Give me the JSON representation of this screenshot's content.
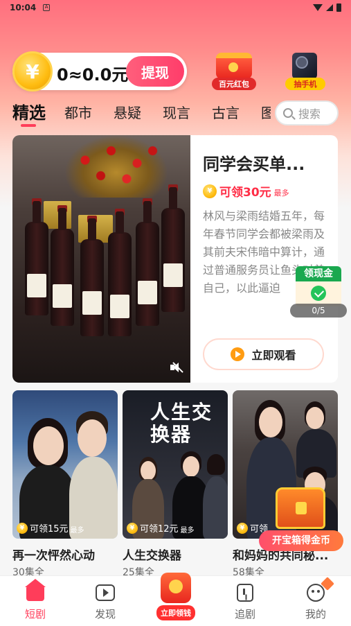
{
  "status_bar": {
    "time": "10:04",
    "app_indicator": "A"
  },
  "header": {
    "coin_value": "0≈0.0元",
    "withdraw_label": "提现",
    "promos": [
      {
        "label": "百元红包",
        "icon": "red-packet-icon"
      },
      {
        "label": "抽手机",
        "icon": "phone-prize-icon"
      }
    ]
  },
  "tabs": {
    "items": [
      "精选",
      "都市",
      "悬疑",
      "现言",
      "古言",
      "图"
    ],
    "active_index": 0,
    "search_placeholder": "搜索"
  },
  "featured": {
    "title": "同学会买单...",
    "reward": "可领30元",
    "reward_max": "最多",
    "description": "林风与梁雨结婚五年，每年春节同学会都被梁雨及其前夫宋伟暗中算计，通过普通服务员让鱼头对着自己，以此逼迫",
    "watch_label": "立即观看"
  },
  "cash_float": {
    "title": "领现金",
    "progress": "0/5"
  },
  "dramas": [
    {
      "title": "再一次怦然心动",
      "episodes": "30集全",
      "reward": "可领15元",
      "reward_max": "最多"
    },
    {
      "title": "人生交换器",
      "episodes": "25集全",
      "reward": "可领12元",
      "reward_max": "最多",
      "poster_text": "人生交换器"
    },
    {
      "title": "和妈妈的共同秘...",
      "episodes": "58集全",
      "reward": "可领",
      "reward_max": ""
    }
  ],
  "chest": {
    "label": "开宝箱得金币"
  },
  "bottom_nav": {
    "items": [
      {
        "label": "短剧",
        "icon": "home-icon",
        "active": true
      },
      {
        "label": "发现",
        "icon": "discover-icon"
      },
      {
        "label": "立即领钱",
        "icon": "earn-money-icon"
      },
      {
        "label": "追剧",
        "icon": "bookmark-icon"
      },
      {
        "label": "我的",
        "icon": "profile-icon"
      }
    ]
  },
  "colors": {
    "accent": "#ff3d5a",
    "reward": "#ff2d46",
    "cash_green": "#1aa84f"
  }
}
